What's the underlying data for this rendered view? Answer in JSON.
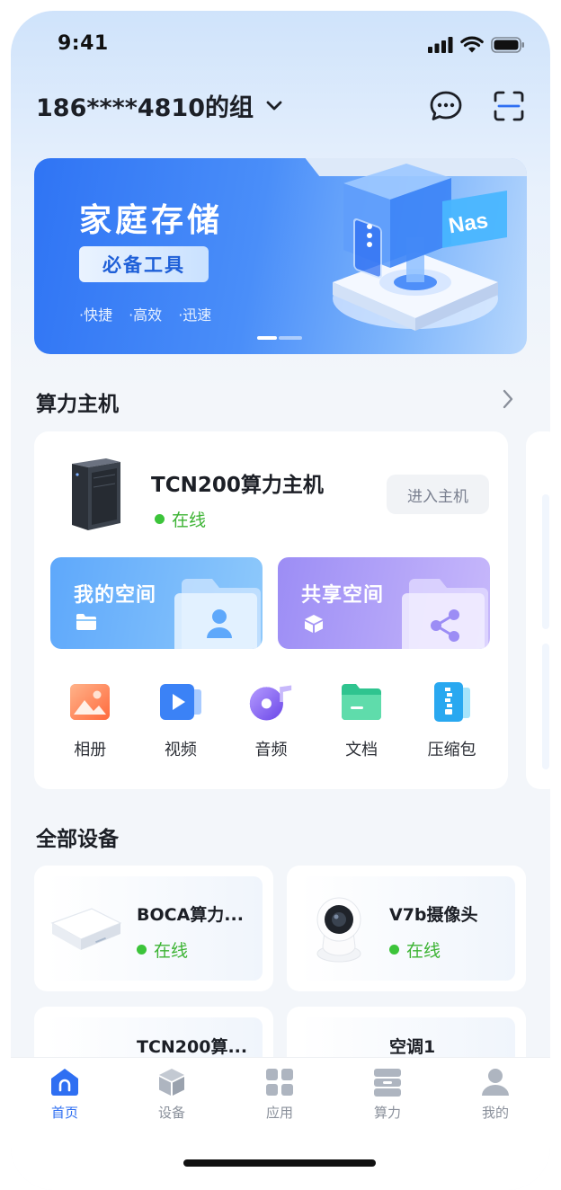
{
  "status_bar": {
    "time": "9:41"
  },
  "header": {
    "group_name": "186****4810的组"
  },
  "banner": {
    "title": "家庭存储",
    "pill": "必备工具",
    "tags": [
      "·快捷",
      "·高效",
      "·迅速"
    ],
    "badge": "Nas"
  },
  "host_section": {
    "title": "算力主机",
    "host": {
      "name": "TCN200算力主机",
      "status": "在线",
      "enter_button": "进入主机"
    },
    "spaces": [
      {
        "label": "我的空间"
      },
      {
        "label": "共享空间"
      }
    ],
    "apps": [
      {
        "label": "相册",
        "icon": "photo-album-icon"
      },
      {
        "label": "视频",
        "icon": "video-icon"
      },
      {
        "label": "音频",
        "icon": "audio-icon"
      },
      {
        "label": "文档",
        "icon": "document-icon"
      },
      {
        "label": "压缩包",
        "icon": "archive-icon"
      }
    ]
  },
  "devices_section": {
    "title": "全部设备",
    "devices": [
      {
        "name": "BOCA算力...",
        "status": "在线"
      },
      {
        "name": "V7b摄像头",
        "status": "在线"
      },
      {
        "name": "TCN200算...",
        "status": ""
      },
      {
        "name": "空调1",
        "status": ""
      }
    ]
  },
  "tabbar": {
    "tabs": [
      {
        "label": "首页",
        "icon": "home-icon",
        "active": true
      },
      {
        "label": "设备",
        "icon": "cube-icon",
        "active": false
      },
      {
        "label": "应用",
        "icon": "grid-icon",
        "active": false
      },
      {
        "label": "算力",
        "icon": "server-icon",
        "active": false
      },
      {
        "label": "我的",
        "icon": "person-icon",
        "active": false
      }
    ]
  },
  "colors": {
    "accent": "#2f6ff2",
    "online": "#3cc43a"
  }
}
